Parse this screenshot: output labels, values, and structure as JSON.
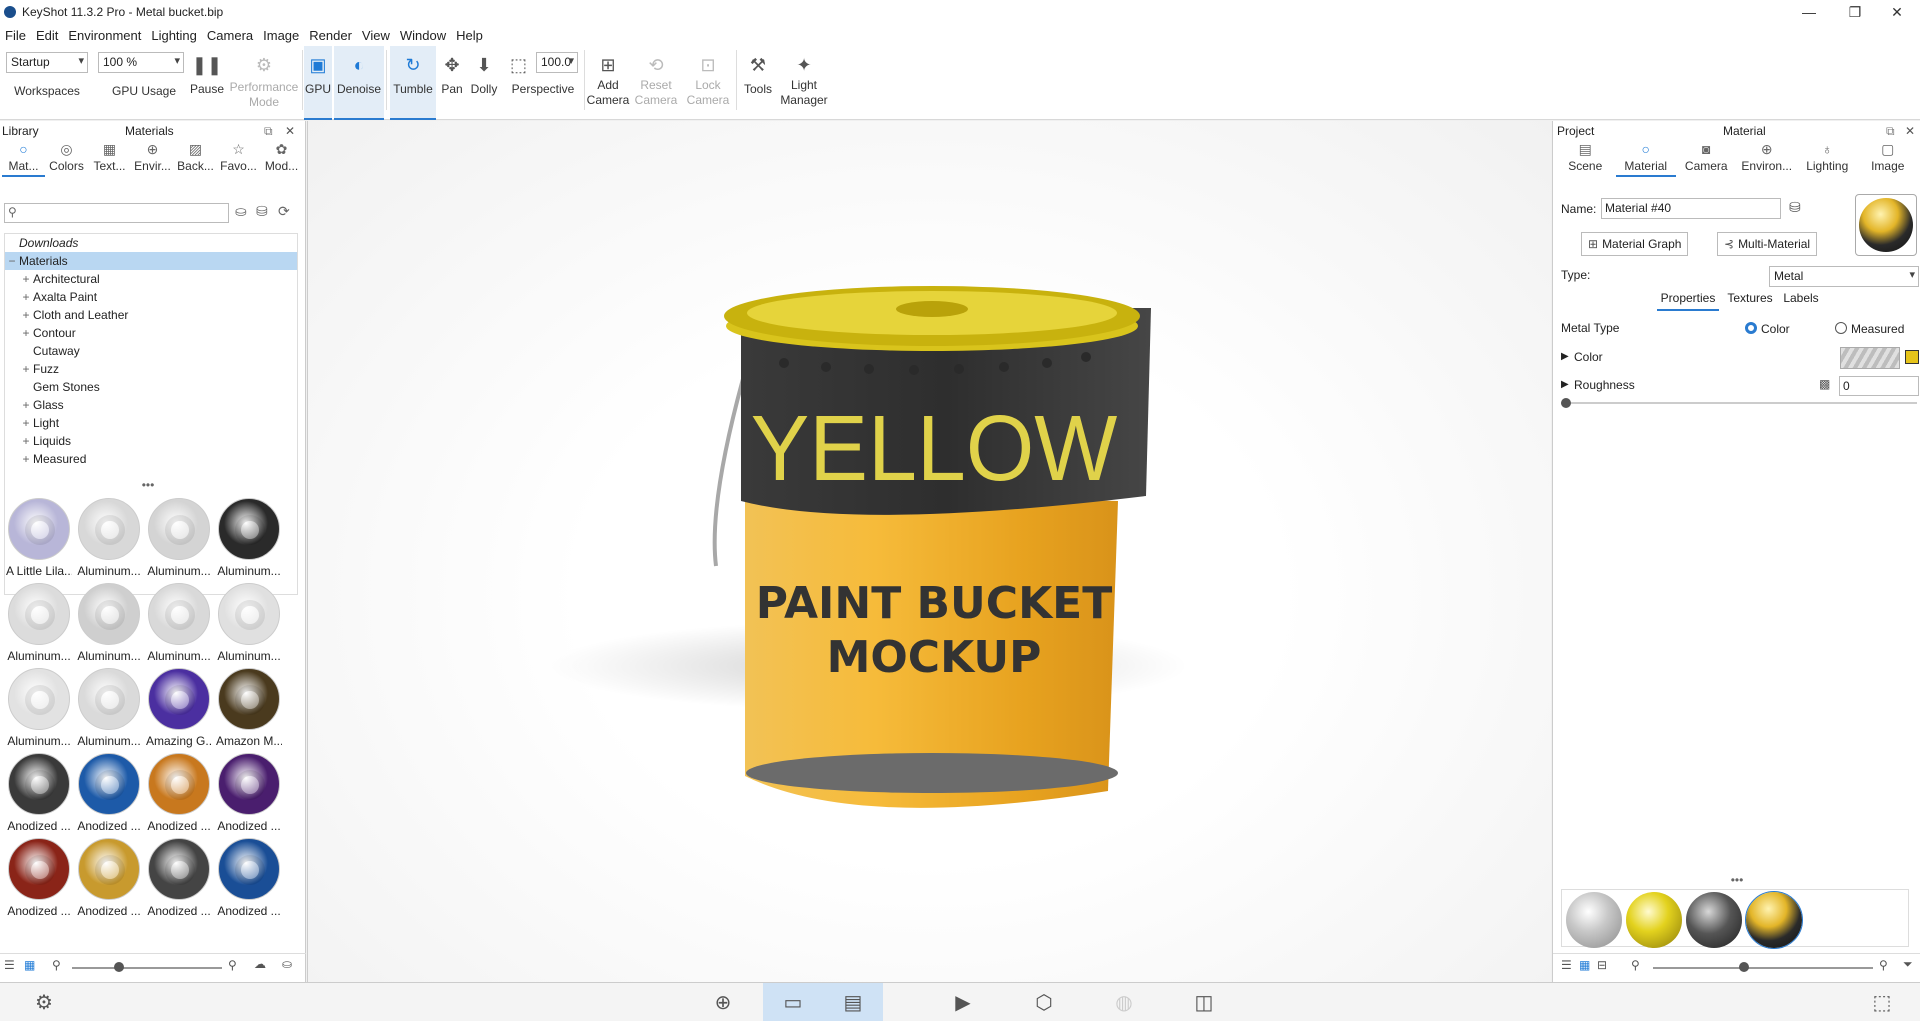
{
  "window": {
    "title": "KeyShot 11.3.2 Pro  - Metal bucket.bip",
    "minimize": "—",
    "restore": "❐",
    "close": "✕"
  },
  "menu": [
    "File",
    "Edit",
    "Environment",
    "Lighting",
    "Camera",
    "Image",
    "Render",
    "View",
    "Window",
    "Help"
  ],
  "toolbar": {
    "workspace_value": "Startup",
    "zoom_value": "100 %",
    "fov_value": "100.0",
    "items": {
      "workspaces": "Workspaces",
      "gpu_usage": "GPU Usage",
      "pause": "Pause",
      "performance_mode": "Performance Mode",
      "gpu": "GPU",
      "denoise": "Denoise",
      "tumble": "Tumble",
      "pan": "Pan",
      "dolly": "Dolly",
      "perspective": "Perspective",
      "add_camera": "Add Camera",
      "reset_camera": "Reset Camera",
      "lock_camera": "Lock Camera",
      "tools": "Tools",
      "light_manager": "Light Manager"
    }
  },
  "library": {
    "header_left": "Library",
    "header_title": "Materials",
    "tabs": [
      "Mat...",
      "Colors",
      "Text...",
      "Envir...",
      "Back...",
      "Favo...",
      "Mod..."
    ],
    "search_placeholder": "",
    "tree": [
      {
        "label": "Downloads",
        "expander": "",
        "italic": true
      },
      {
        "label": "Materials",
        "expander": "−",
        "selected": true
      },
      {
        "label": "Architectural",
        "expander": "+"
      },
      {
        "label": "Axalta Paint",
        "expander": "+"
      },
      {
        "label": "Cloth and Leather",
        "expander": "+"
      },
      {
        "label": "Contour",
        "expander": "+"
      },
      {
        "label": "Cutaway",
        "expander": ""
      },
      {
        "label": "Fuzz",
        "expander": "+"
      },
      {
        "label": "Gem Stones",
        "expander": ""
      },
      {
        "label": "Glass",
        "expander": "+"
      },
      {
        "label": "Light",
        "expander": "+"
      },
      {
        "label": "Liquids",
        "expander": "+"
      },
      {
        "label": "Measured",
        "expander": "+"
      }
    ],
    "divider_dots": "•••",
    "thumbnails": [
      {
        "label": "A Little Lila...",
        "color": "#b8b6d8"
      },
      {
        "label": "Aluminum...",
        "color": "#d8d8d8"
      },
      {
        "label": "Aluminum...",
        "color": "#d4d4d4"
      },
      {
        "label": "Aluminum...",
        "color": "#2a2a2a"
      },
      {
        "label": "Aluminum...",
        "color": "#dcdcdc"
      },
      {
        "label": "Aluminum...",
        "color": "#cfcfcf"
      },
      {
        "label": "Aluminum...",
        "color": "#d9d9d9"
      },
      {
        "label": "Aluminum...",
        "color": "#e0e0e0"
      },
      {
        "label": "Aluminum...",
        "color": "#e2e2e2"
      },
      {
        "label": "Aluminum...",
        "color": "#dadada"
      },
      {
        "label": "Amazing G...",
        "color": "#4b2fa0"
      },
      {
        "label": "Amazon M...",
        "color": "#4a3a1e"
      },
      {
        "label": "Anodized ...",
        "color": "#3a3a3a"
      },
      {
        "label": "Anodized ...",
        "color": "#1d5aa8"
      },
      {
        "label": "Anodized ...",
        "color": "#c8781e"
      },
      {
        "label": "Anodized ...",
        "color": "#4a1e6e"
      },
      {
        "label": "Anodized ...",
        "color": "#8a2418"
      },
      {
        "label": "Anodized ...",
        "color": "#c89a2e"
      },
      {
        "label": "Anodized ...",
        "color": "#444444"
      },
      {
        "label": "Anodized ...",
        "color": "#1a4e96"
      }
    ]
  },
  "viewport": {
    "lid_text": "YELLOW",
    "label_line1": "PAINT BUCKET",
    "label_line2": "MOCKUP"
  },
  "material_panel": {
    "header_left": "Project",
    "header_title": "Material",
    "tabs": [
      "Scene",
      "Material",
      "Camera",
      "Environ...",
      "Lighting",
      "Image"
    ],
    "name_label": "Name:",
    "name_value": "Material #40",
    "material_graph": "Material Graph",
    "multi_material": "Multi-Material",
    "type_label": "Type:",
    "type_value": "Metal",
    "sub_tabs": [
      "Properties",
      "Textures",
      "Labels"
    ],
    "metal_type_label": "Metal Type",
    "option_color": "Color",
    "option_measured": "Measured",
    "color_label": "Color",
    "roughness_label": "Roughness",
    "roughness_value": "0",
    "divider_dots": "•••"
  },
  "colors": {
    "accent": "#2a7bd0",
    "bucket_yellow": "#f0b32c",
    "band": "#333333"
  }
}
